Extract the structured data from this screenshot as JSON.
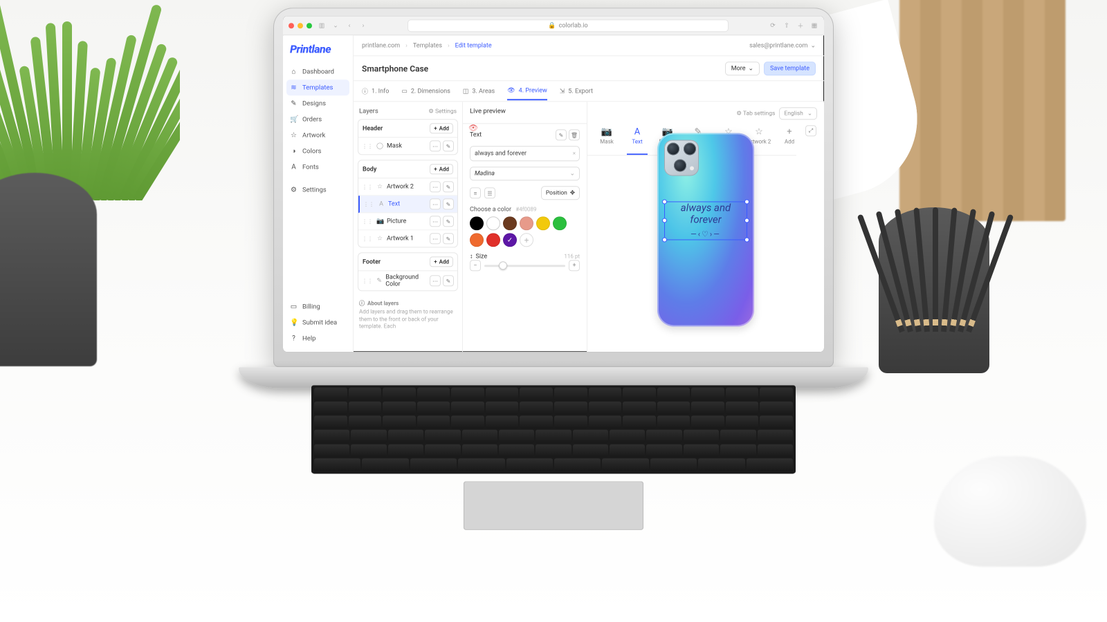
{
  "browser": {
    "url": "colorlab.io"
  },
  "brand": "Printlane",
  "user_email": "sales@printlane.com",
  "sidebar": {
    "primary": [
      {
        "label": "Dashboard",
        "icon": "home"
      },
      {
        "label": "Templates",
        "icon": "layers",
        "active": true
      },
      {
        "label": "Designs",
        "icon": "pencil"
      },
      {
        "label": "Orders",
        "icon": "cart"
      },
      {
        "label": "Artwork",
        "icon": "star"
      },
      {
        "label": "Colors",
        "icon": "palette"
      },
      {
        "label": "Fonts",
        "icon": "font"
      }
    ],
    "secondary": [
      {
        "label": "Settings",
        "icon": "sliders"
      }
    ],
    "footer": [
      {
        "label": "Billing",
        "icon": "card"
      },
      {
        "label": "Submit idea",
        "icon": "bulb"
      },
      {
        "label": "Help",
        "icon": "help"
      }
    ]
  },
  "breadcrumbs": [
    "printlane.com",
    "Templates",
    "Edit template"
  ],
  "page_title": "Smartphone Case",
  "buttons": {
    "more": "More",
    "save": "Save template"
  },
  "steps": [
    {
      "label": "1. Info",
      "icon": "info"
    },
    {
      "label": "2. Dimensions",
      "icon": "dim"
    },
    {
      "label": "3. Areas",
      "icon": "areas"
    },
    {
      "label": "4. Preview",
      "icon": "eye",
      "active": true
    },
    {
      "label": "5. Export",
      "icon": "export"
    }
  ],
  "layers": {
    "title": "Layers",
    "settings": "Settings",
    "add": "Add",
    "groups": [
      {
        "name": "Header",
        "items": [
          {
            "label": "Mask",
            "icon": "mask"
          }
        ]
      },
      {
        "name": "Body",
        "items": [
          {
            "label": "Artwork 2",
            "icon": "star"
          },
          {
            "label": "Text",
            "icon": "text",
            "selected": true
          },
          {
            "label": "Picture",
            "icon": "camera"
          },
          {
            "label": "Artwork 1",
            "icon": "star"
          }
        ]
      },
      {
        "name": "Footer",
        "items": [
          {
            "label": "Background Color",
            "icon": "brush"
          }
        ]
      }
    ],
    "about_title": "About layers",
    "about_text": "Add layers and drag them to rearrange them to the front or back of your template. Each"
  },
  "editor": {
    "live_preview": "Live preview",
    "tab_settings": "Tab settings",
    "language": "English",
    "tabs": [
      {
        "label": "Mask"
      },
      {
        "label": "Text",
        "active": true
      },
      {
        "label": "Picture"
      },
      {
        "label": "Background Color"
      },
      {
        "label": "Artwork 1"
      },
      {
        "label": "Artwork 2"
      },
      {
        "label": "Add"
      }
    ],
    "text_label": "Text",
    "text_value": "always and forever",
    "font": "Madina",
    "position": "Position",
    "color_label": "Choose a color",
    "color_hex": "#4f0089",
    "colors": [
      "#000000",
      "#ffffff",
      "#6b3a1f",
      "#e79a8a",
      "#f2c90c",
      "#2bbf3e",
      "#ef6a2e",
      "#e0302a",
      "#5d17a6"
    ],
    "selected_color": "#5d17a6",
    "size_label": "Size",
    "size_value": "116 pt"
  },
  "preview_text": "always and forever"
}
